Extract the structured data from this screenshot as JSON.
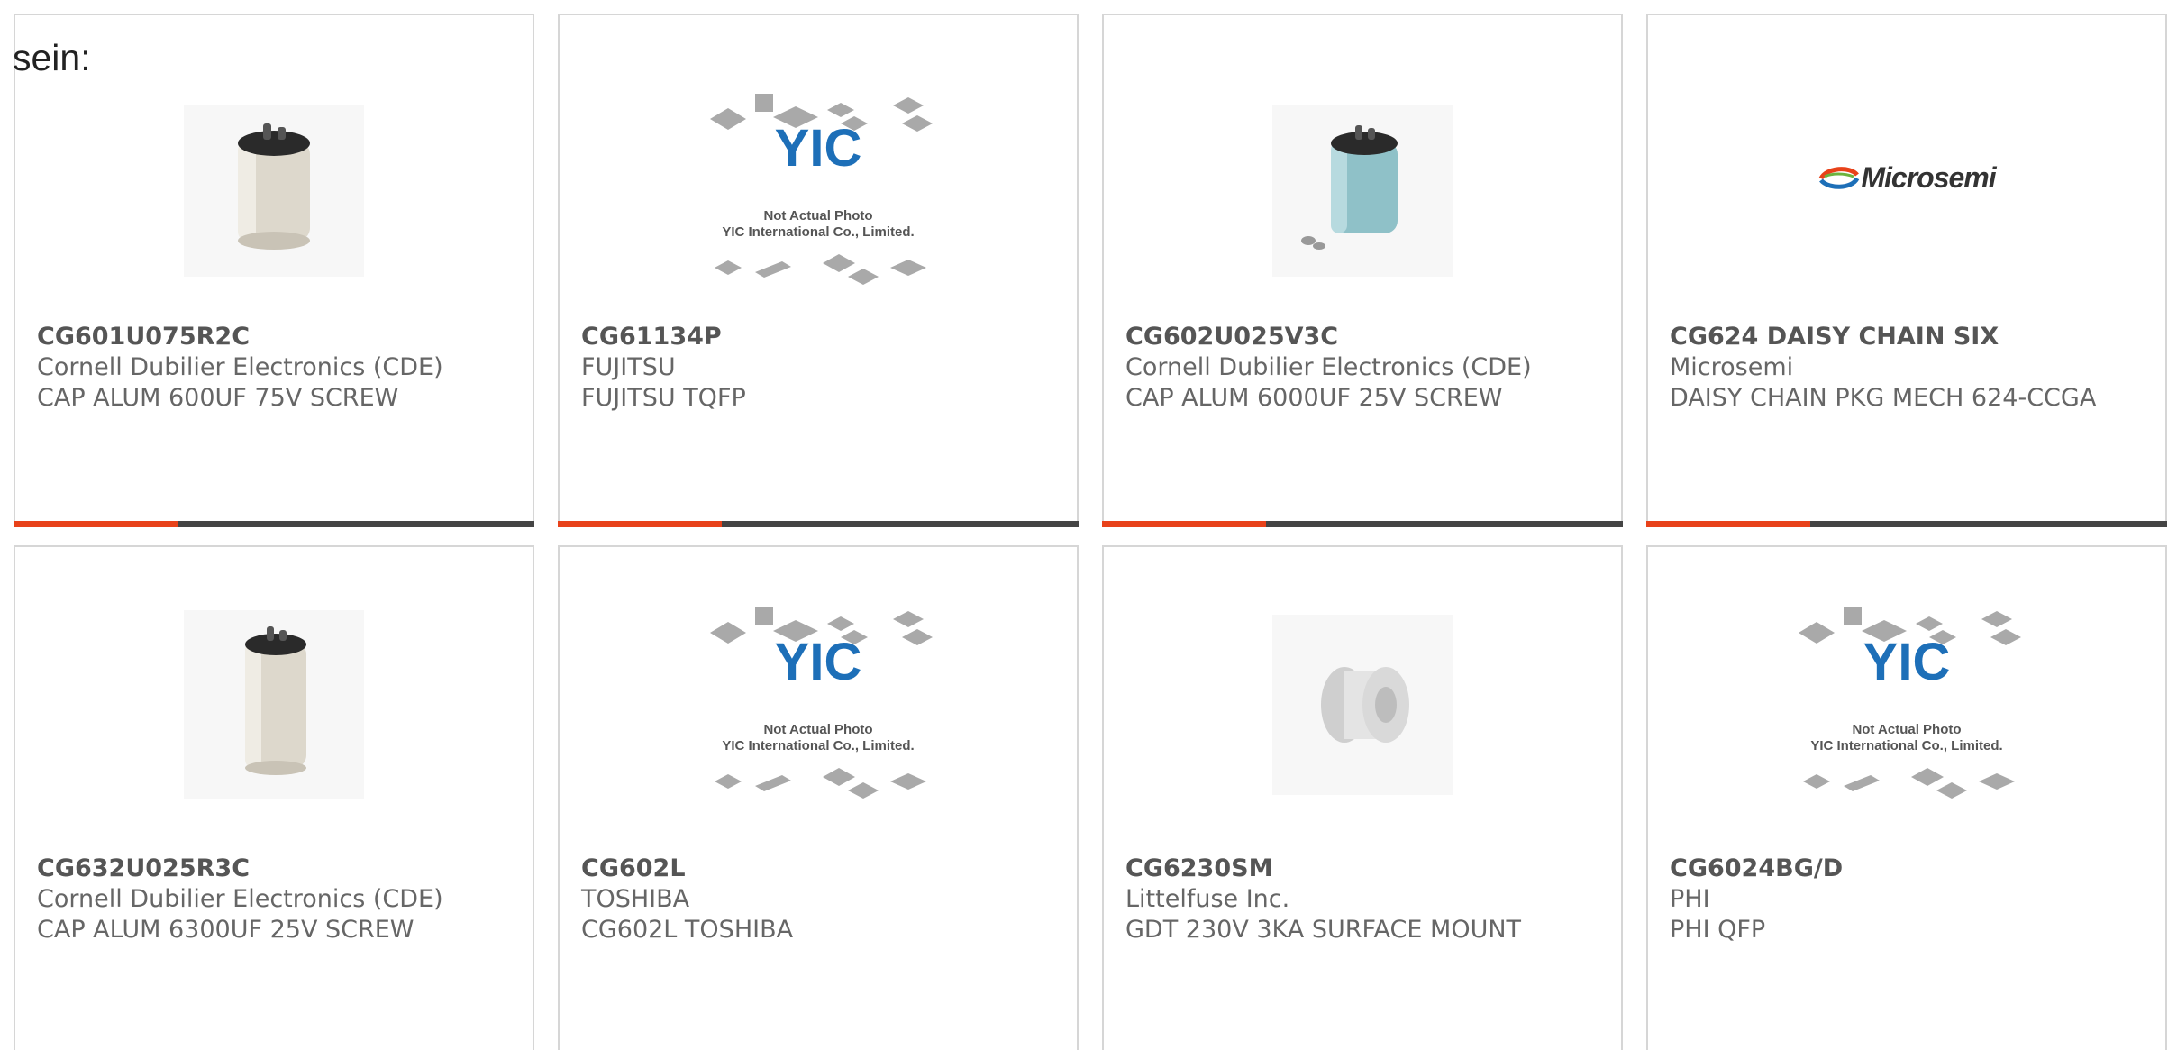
{
  "intro_text": "sein:",
  "colors": {
    "accent": "#e8421a",
    "bar": "#444444",
    "border": "#d6d6d6"
  },
  "cards": [
    {
      "part": "CG601U075R2C",
      "manufacturer": "Cornell Dubilier Electronics (CDE)",
      "description": "CAP ALUM 600UF 75V SCREW",
      "image": "capacitor-cream"
    },
    {
      "part": "CG61134P",
      "manufacturer": "FUJITSU",
      "description": "FUJITSU TQFP",
      "image": "yic-placeholder",
      "placeholder": {
        "brand": "YIC",
        "line1": "Not Actual Photo",
        "line2": "YIC International Co., Limited."
      }
    },
    {
      "part": "CG602U025V3C",
      "manufacturer": "Cornell Dubilier Electronics (CDE)",
      "description": "CAP ALUM 6000UF 25V SCREW",
      "image": "capacitor-blue"
    },
    {
      "part": "CG624 DAISY CHAIN SIX",
      "manufacturer": "Microsemi",
      "description": "DAISY CHAIN PKG MECH 624-CCGA",
      "image": "microsemi-logo",
      "logo_text": "Microsemi"
    },
    {
      "part": "CG632U025R3C",
      "manufacturer": "Cornell Dubilier Electronics (CDE)",
      "description": "CAP ALUM 6300UF 25V SCREW",
      "image": "capacitor-cream"
    },
    {
      "part": "CG602L",
      "manufacturer": "TOSHIBA",
      "description": "CG602L TOSHIBA",
      "image": "yic-placeholder",
      "placeholder": {
        "brand": "YIC",
        "line1": "Not Actual Photo",
        "line2": "YIC International Co., Limited."
      }
    },
    {
      "part": "CG6230SM",
      "manufacturer": "Littelfuse Inc.",
      "description": "GDT 230V 3KA SURFACE MOUNT",
      "image": "gdt-component"
    },
    {
      "part": "CG6024BG/D",
      "manufacturer": "PHI",
      "description": "PHI QFP",
      "image": "yic-placeholder",
      "placeholder": {
        "brand": "YIC",
        "line1": "Not Actual Photo",
        "line2": "YIC International Co., Limited."
      }
    }
  ]
}
